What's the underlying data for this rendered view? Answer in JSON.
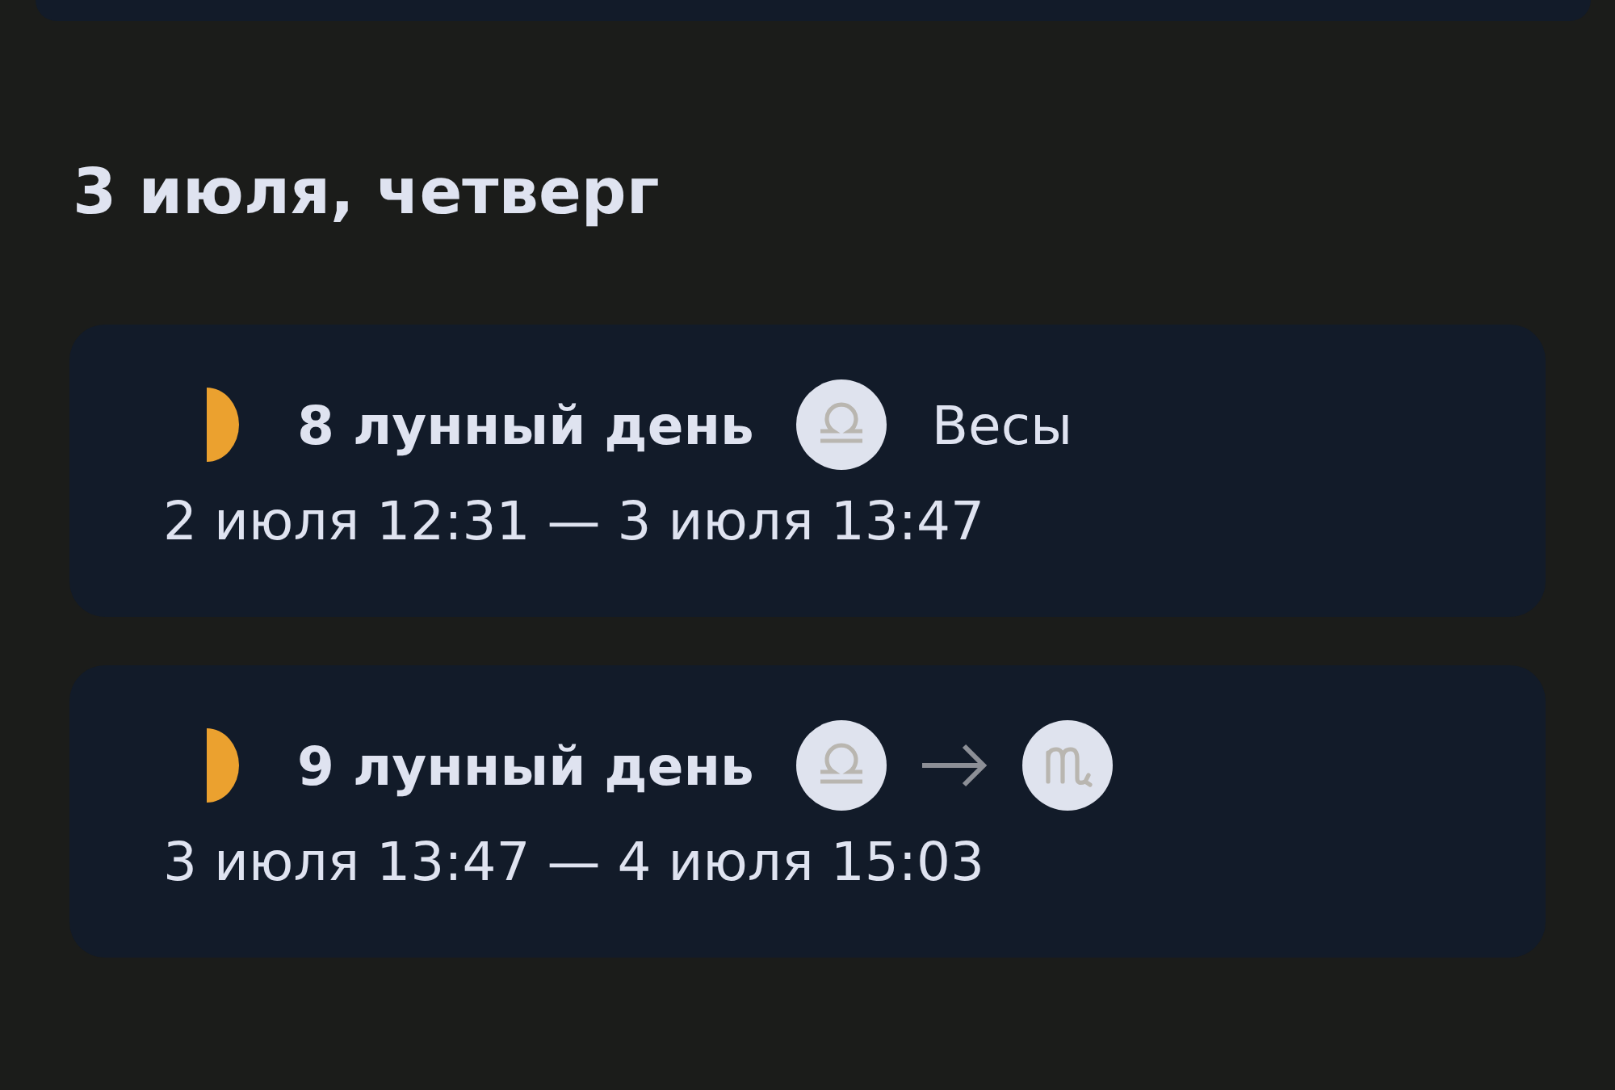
{
  "heading": "3 июля, четверг",
  "days": [
    {
      "moon": {
        "kind": "first_quarter"
      },
      "title": "8 лунный день",
      "signs": [
        {
          "kind": "libra"
        }
      ],
      "sign_name": "Весы",
      "period": "2 июля 12:31 — 3 июля 13:47"
    },
    {
      "moon": {
        "kind": "first_quarter"
      },
      "title": "9 лунный день",
      "signs": [
        {
          "kind": "libra"
        },
        {
          "kind": "scorpio"
        }
      ],
      "period": "3 июля 13:47 — 4 июля 15:03"
    }
  ]
}
